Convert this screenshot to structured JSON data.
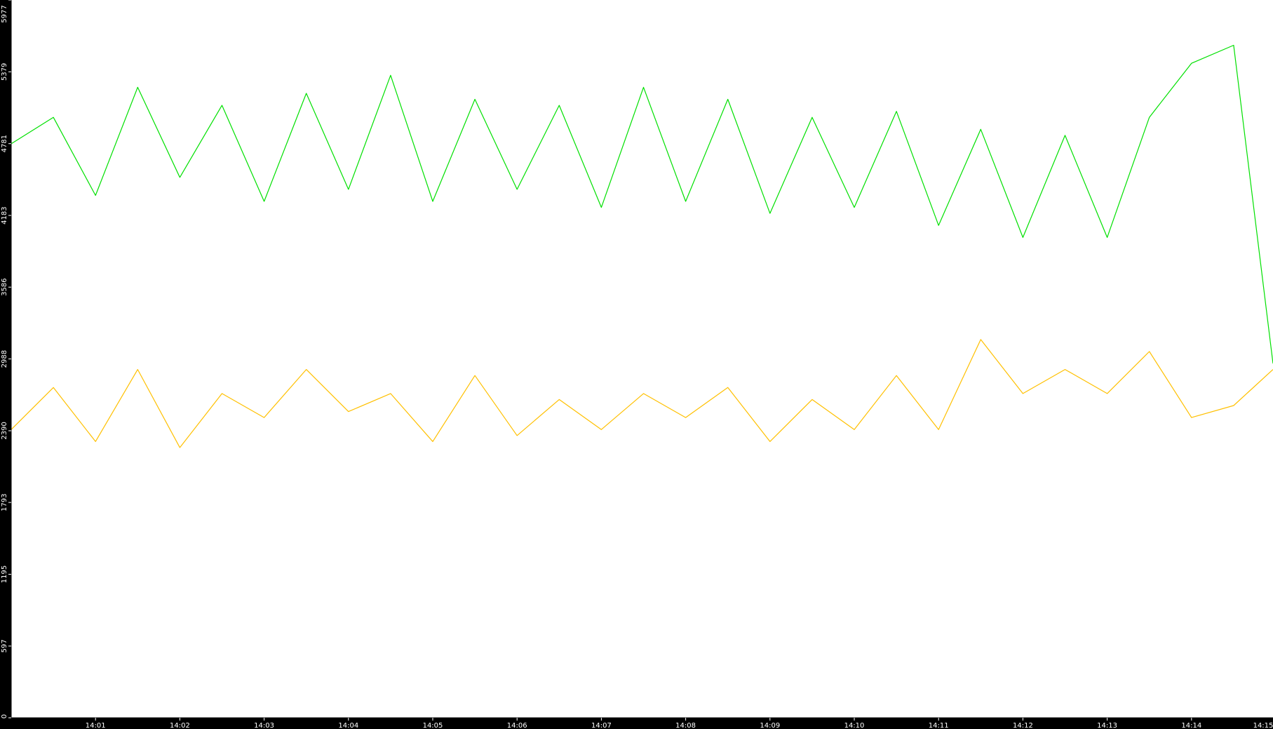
{
  "chart_data": {
    "type": "line",
    "title": "",
    "xlabel": "",
    "ylabel": "",
    "ylim": [
      0,
      5977
    ],
    "yticks": [
      0,
      597,
      1195,
      1793,
      2390,
      2988,
      3586,
      4183,
      4781,
      5379,
      5977
    ],
    "ytick_labels": [
      "0",
      "597",
      "1195",
      "1793",
      "2390",
      "2988",
      "3586",
      "4183",
      "4781",
      "5379",
      "5977"
    ],
    "xlim": [
      "14:00:00",
      "14:14:58"
    ],
    "xticks": [
      "14:01",
      "14:02",
      "14:03",
      "14:04",
      "14:05",
      "14:06",
      "14:07",
      "14:08",
      "14:09",
      "14:10",
      "14:11",
      "14:12",
      "14:13",
      "14:14",
      "14:15"
    ],
    "grid": false,
    "legend": "none",
    "background": "#ffffff",
    "axis_color": "#000000",
    "label_color": "#ffffff",
    "series": [
      {
        "color": "#00e000",
        "x": [
          "14:00:00",
          "14:00:30",
          "14:01:00",
          "14:01:30",
          "14:02:00",
          "14:02:30",
          "14:03:00",
          "14:03:30",
          "14:04:00",
          "14:04:30",
          "14:05:00",
          "14:05:30",
          "14:06:00",
          "14:06:30",
          "14:07:00",
          "14:07:30",
          "14:08:00",
          "14:08:30",
          "14:09:00",
          "14:09:30",
          "14:10:00",
          "14:10:30",
          "14:11:00",
          "14:11:30",
          "14:12:00",
          "14:12:30",
          "14:13:00",
          "14:13:30",
          "14:14:00",
          "14:14:30",
          "14:14:58"
        ],
        "values": [
          4780,
          5000,
          4350,
          5250,
          4500,
          5100,
          4300,
          5200,
          4400,
          5350,
          4300,
          5150,
          4400,
          5100,
          4250,
          5250,
          4300,
          5150,
          4200,
          5000,
          4250,
          5050,
          4100,
          4900,
          4000,
          4850,
          4000,
          5000,
          5450,
          5600,
          2950
        ]
      },
      {
        "color": "#ffc000",
        "x": [
          "14:00:00",
          "14:00:30",
          "14:01:00",
          "14:01:30",
          "14:02:00",
          "14:02:30",
          "14:03:00",
          "14:03:30",
          "14:04:00",
          "14:04:30",
          "14:05:00",
          "14:05:30",
          "14:06:00",
          "14:06:30",
          "14:07:00",
          "14:07:30",
          "14:08:00",
          "14:08:30",
          "14:09:00",
          "14:09:30",
          "14:10:00",
          "14:10:30",
          "14:11:00",
          "14:11:30",
          "14:12:00",
          "14:12:30",
          "14:13:00",
          "14:13:30",
          "14:14:00",
          "14:14:30",
          "14:14:58"
        ],
        "values": [
          2400,
          2750,
          2300,
          2900,
          2250,
          2700,
          2500,
          2900,
          2550,
          2700,
          2300,
          2850,
          2350,
          2650,
          2400,
          2700,
          2500,
          2750,
          2300,
          2650,
          2400,
          2850,
          2400,
          3150,
          2700,
          2900,
          2700,
          3050,
          2500,
          2600,
          2900
        ]
      }
    ]
  }
}
